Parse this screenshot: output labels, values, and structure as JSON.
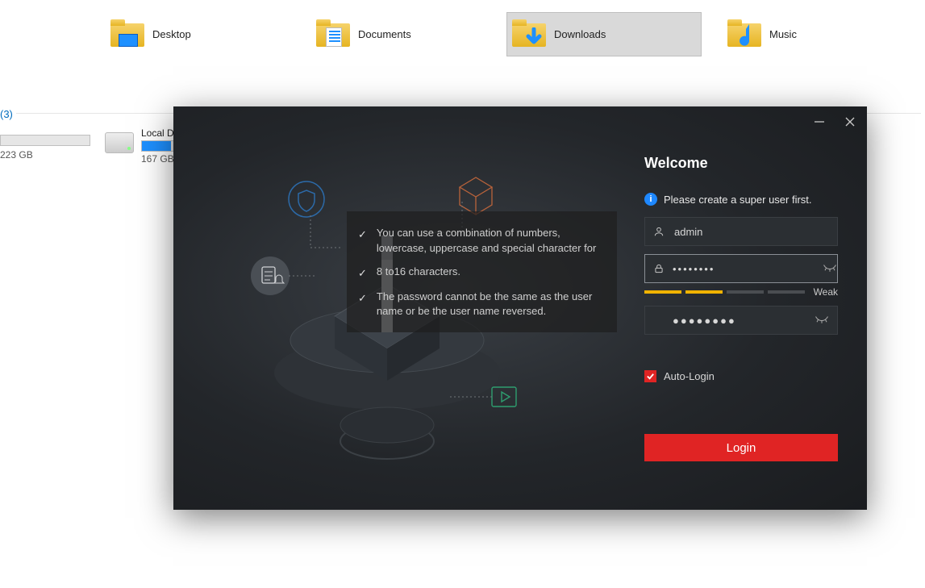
{
  "explorer": {
    "folders": [
      {
        "label": "Desktop"
      },
      {
        "label": "Documents"
      },
      {
        "label": "Downloads"
      },
      {
        "label": "Music"
      }
    ],
    "drives_header": "(3)",
    "drive0_free": "223 GB",
    "drive1": {
      "name": "Local D",
      "free": "167 GB",
      "fill_pct": 33
    }
  },
  "modal": {
    "title": "Welcome",
    "instruction": "Please create a super user first.",
    "username": "admin",
    "password_mask": "●●●●●●●●",
    "confirm_mask": "●●●●●●●●",
    "strength_label": "Weak",
    "tips": [
      "You can use a combination of numbers, lowercase, uppercase and special character for",
      "8 to16 characters.",
      "The password cannot be the same as the user name or be the user name reversed."
    ],
    "auto_login_label": "Auto-Login",
    "login_button": "Login"
  }
}
